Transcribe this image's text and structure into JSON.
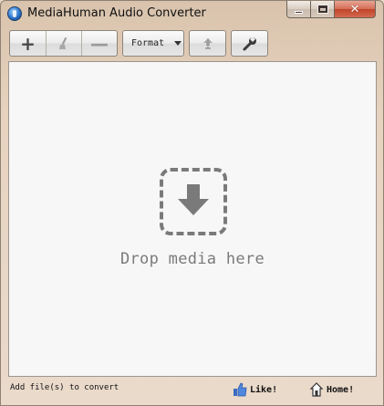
{
  "window": {
    "title": "MediaHuman Audio Converter",
    "caption_close": "✕"
  },
  "toolbar": {
    "add_symbol": "+",
    "remove_symbol": "—",
    "format_label": "Format"
  },
  "drop_area": {
    "text": "Drop media here"
  },
  "status_bar": {
    "text": "Add file(s) to convert",
    "like_label": "Like!",
    "home_label": "Home!"
  },
  "colors": {
    "frame": "#e7d3bf",
    "drop_bg": "#f7f7f7",
    "drop_ink": "#7a7a7a",
    "close_red": "#c0442a"
  },
  "icons": {
    "app": "mediahuman-app-icon",
    "clear": "broom-icon",
    "convert": "convert-icon",
    "settings": "wrench-icon",
    "drop": "download-arrow-icon",
    "like": "thumbs-up-icon",
    "home": "home-icon"
  }
}
